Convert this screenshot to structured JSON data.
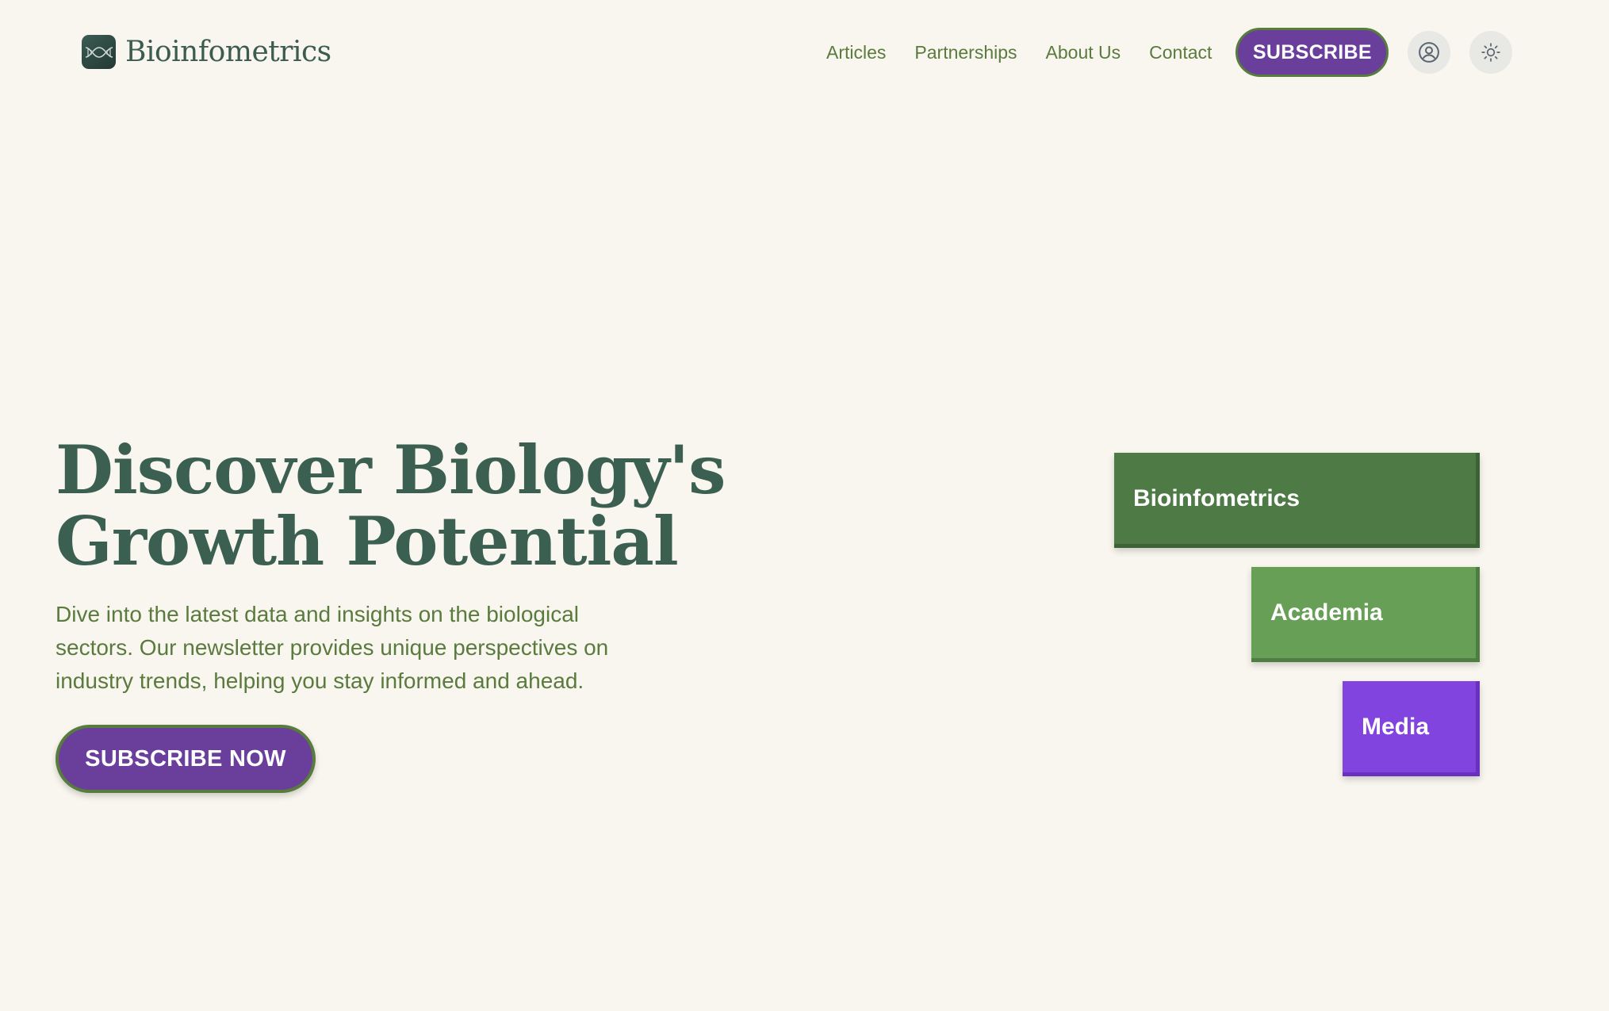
{
  "header": {
    "brand_name": "Bioinfometrics",
    "logo_icon": "dna-icon",
    "nav": {
      "articles": "Articles",
      "partnerships": "Partnerships",
      "about": "About Us",
      "contact": "Contact"
    },
    "subscribe_label": "SUBSCRIBE",
    "user_icon": "user-circle-icon",
    "theme_icon": "sun-icon"
  },
  "hero": {
    "title_line1": "Discover Biology's",
    "title_line2": "Growth Potential",
    "description": "Dive into the latest data and insights on the biological sectors. Our newsletter provides unique perspectives on industry trends, helping you stay informed and ahead.",
    "cta_label": "SUBSCRIBE NOW"
  },
  "audience_cards": [
    {
      "label": "Bioinfometrics",
      "color": "#4d7a45"
    },
    {
      "label": "Academia",
      "color": "#679f57"
    },
    {
      "label": "Media",
      "color": "#8244df"
    }
  ],
  "colors": {
    "background": "#f8f6ee",
    "brand_text": "#3c5c50",
    "nav_text": "#5a7a3e",
    "primary_purple": "#6a3f9c",
    "button_border": "#577c3c"
  }
}
